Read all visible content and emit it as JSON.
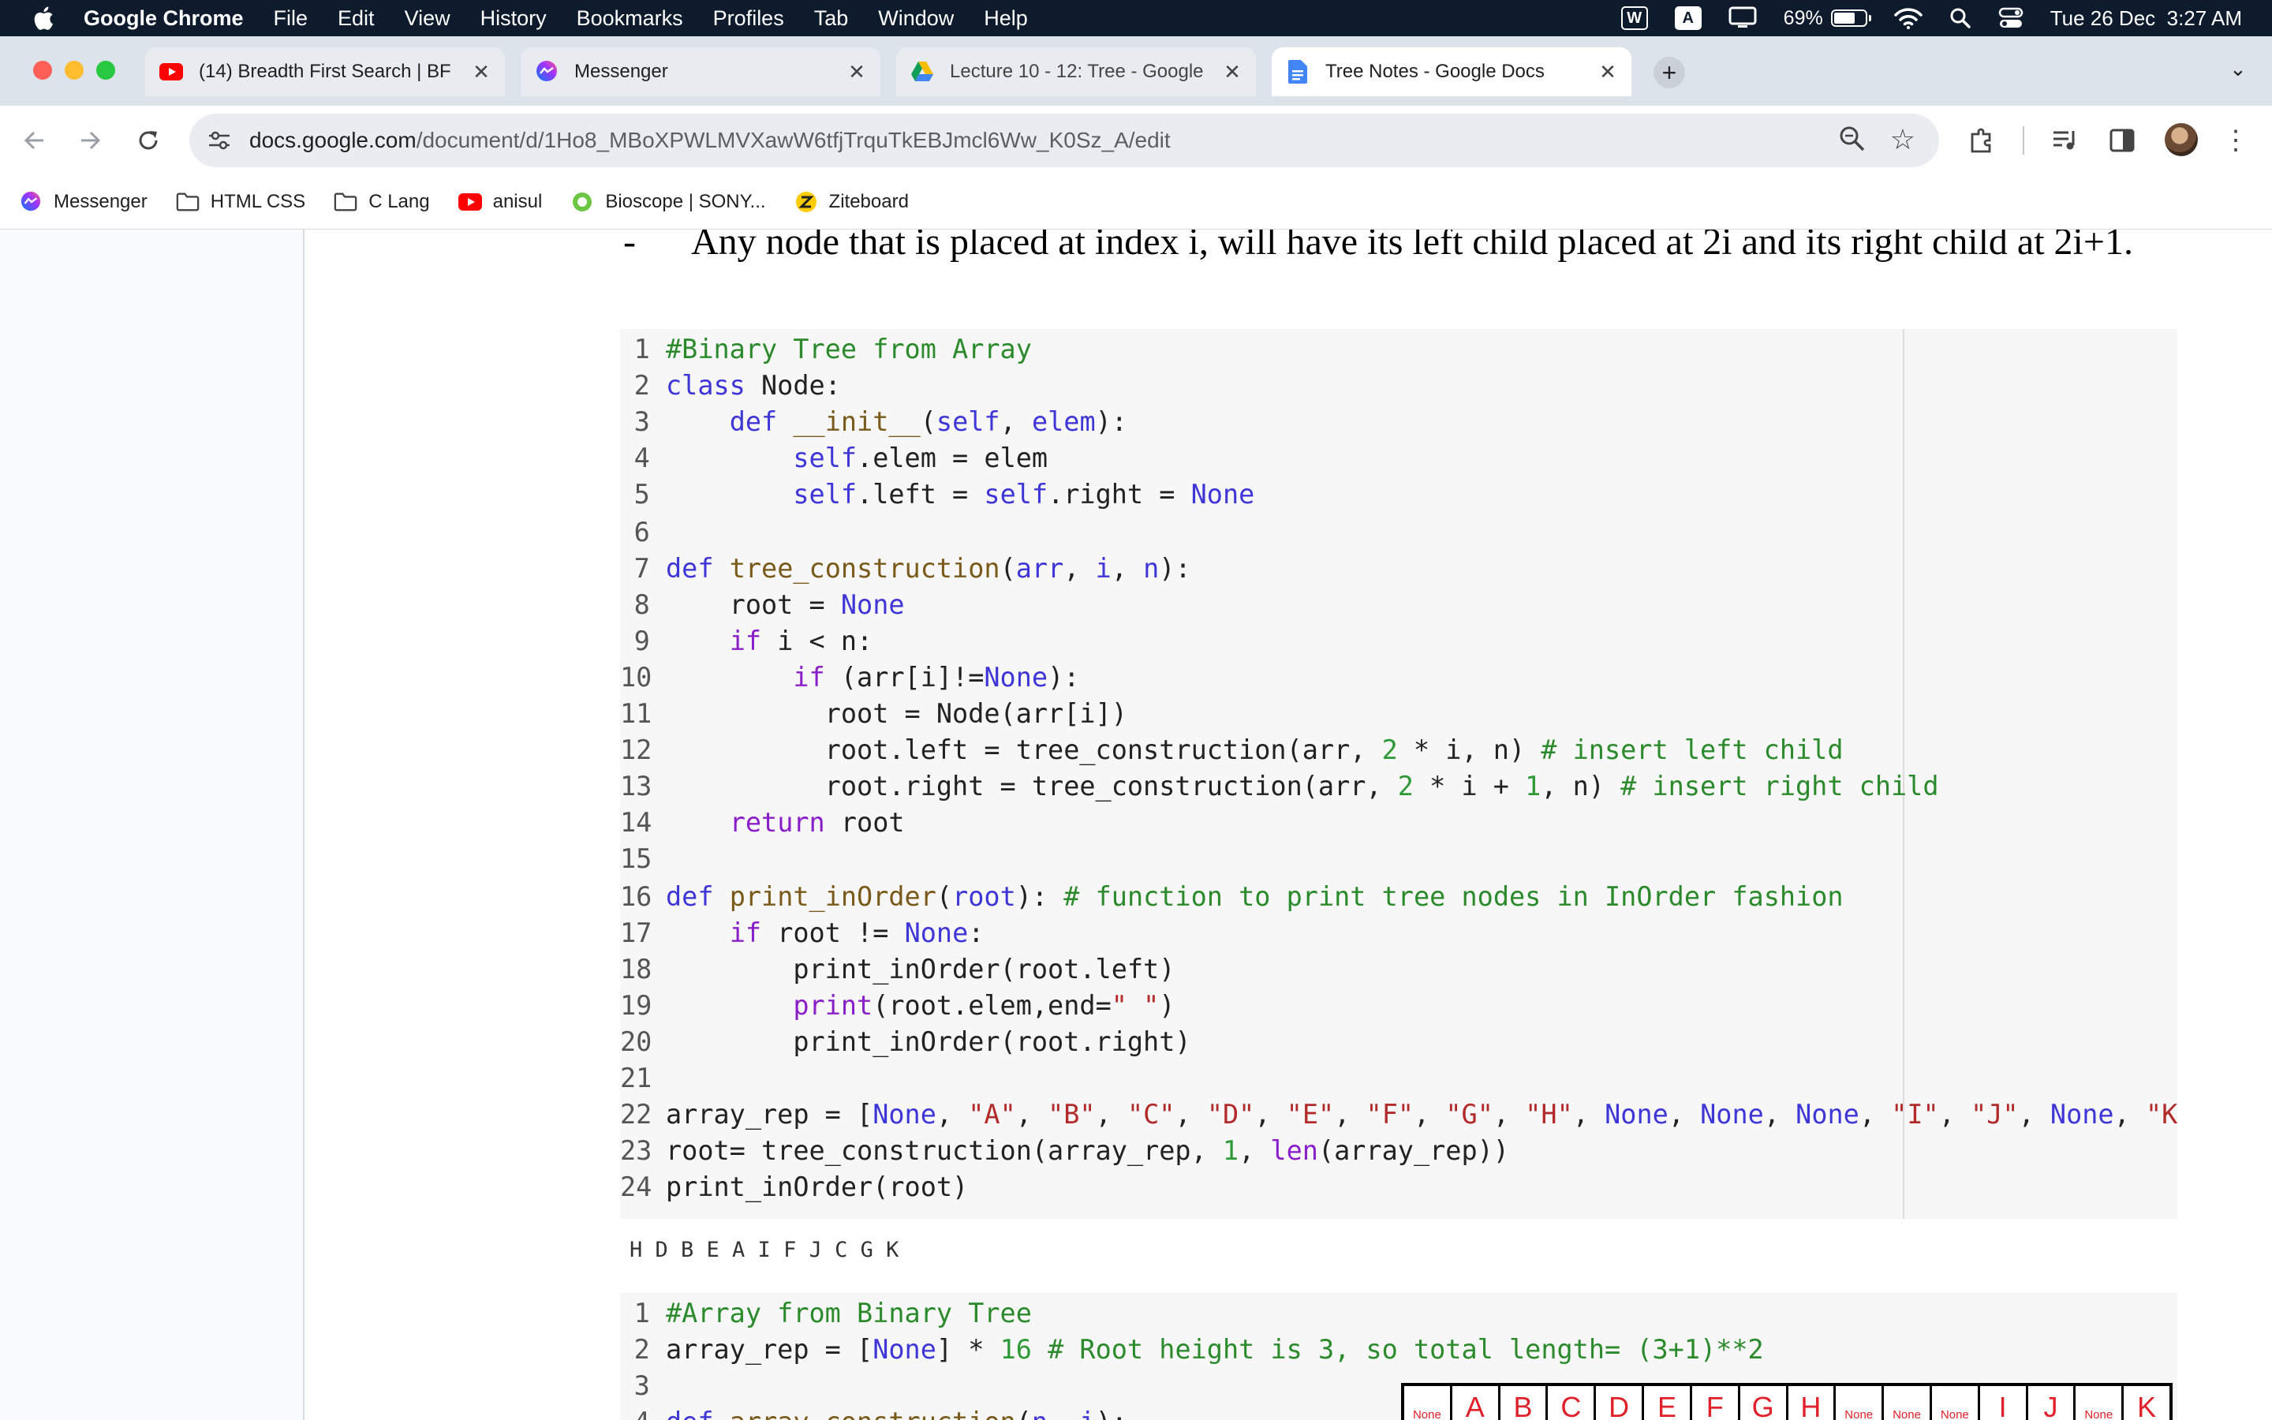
{
  "menubar": {
    "app": "Google Chrome",
    "items": [
      "File",
      "Edit",
      "View",
      "History",
      "Bookmarks",
      "Profiles",
      "Tab",
      "Window",
      "Help"
    ],
    "status": {
      "w_icon": "W",
      "a_icon": "A",
      "battery_percent": "69%",
      "battery_level": 0.69,
      "datetime": "Tue 26 Dec  3:27 AM"
    }
  },
  "tabs": [
    {
      "title": "(14) Breadth First Search | BF",
      "favicon": "youtube-icon",
      "active": false
    },
    {
      "title": "Messenger",
      "favicon": "messenger-icon",
      "active": false
    },
    {
      "title": "Lecture 10 - 12: Tree - Google",
      "favicon": "google-drive-icon",
      "active": false
    },
    {
      "title": "Tree Notes - Google Docs",
      "favicon": "google-docs-icon",
      "active": true
    }
  ],
  "omnibox": {
    "host": "docs.google.com",
    "path": "/document/d/1Ho8_MBoXPWLMVXawW6tfjTrquTkEBJmcl6Ww_K0Sz_A/edit"
  },
  "bookmarks": [
    {
      "label": "Messenger",
      "icon": "messenger-icon"
    },
    {
      "label": "HTML CSS",
      "icon": "folder-icon"
    },
    {
      "label": "C Lang",
      "icon": "folder-icon"
    },
    {
      "label": "anisul",
      "icon": "youtube-icon"
    },
    {
      "label": "Bioscope | SONY...",
      "icon": "bioscope-icon"
    },
    {
      "label": "Ziteboard",
      "icon": "ziteboard-icon"
    }
  ],
  "doc": {
    "bullet_dash": "-",
    "bullet_text": "Any node that is placed at index i, will have its left child placed at 2i and its right child at 2i+1.",
    "output": "H D B E A I F J C G K",
    "array_cells": [
      "None",
      "A",
      "B",
      "C",
      "D",
      "E",
      "F",
      "G",
      "H",
      "None",
      "None",
      "None",
      "I",
      "J",
      "None",
      "K"
    ]
  },
  "colors": {
    "menubar_bg": "#0e1b2d",
    "tabstrip_bg": "#dde3ea",
    "comment": "#2b8a2b",
    "keyword": "#3f36d8",
    "number": "#2e9a37",
    "string": "#b22a2a"
  }
}
